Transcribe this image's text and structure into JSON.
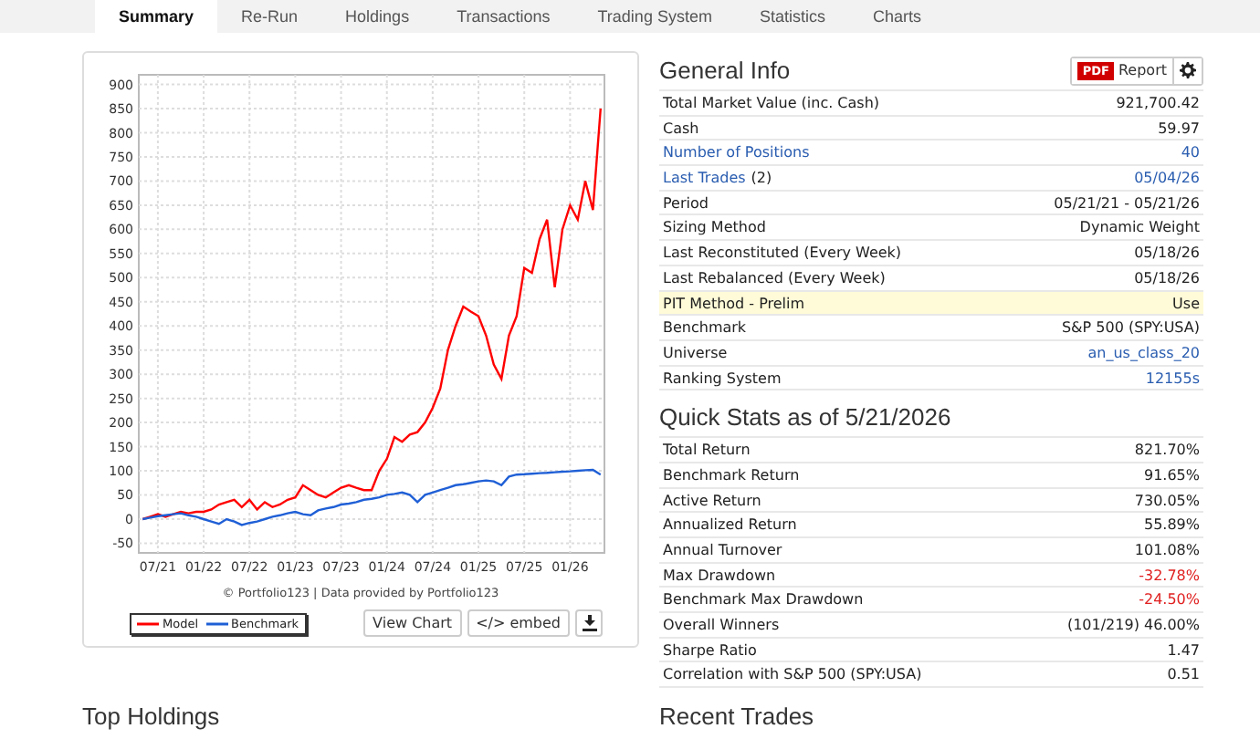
{
  "tabs": [
    {
      "label": "Summary",
      "selected": true
    },
    {
      "label": "Re-Run",
      "selected": false
    },
    {
      "label": "Holdings",
      "selected": false
    },
    {
      "label": "Transactions",
      "selected": false
    },
    {
      "label": "Trading System",
      "selected": false
    },
    {
      "label": "Statistics",
      "selected": false
    },
    {
      "label": "Charts",
      "selected": false
    }
  ],
  "chart": {
    "chart_data": {
      "type": "line",
      "categories": [
        null,
        null,
        "07/21",
        null,
        null,
        null,
        null,
        null,
        "01/22",
        null,
        null,
        null,
        null,
        null,
        "07/22",
        null,
        null,
        null,
        null,
        null,
        "01/23",
        null,
        null,
        null,
        null,
        null,
        "07/23",
        null,
        null,
        null,
        null,
        null,
        "01/24",
        null,
        null,
        null,
        null,
        null,
        "07/24",
        null,
        null,
        null,
        null,
        null,
        "01/25",
        null,
        null,
        null,
        null,
        null,
        "07/25",
        null,
        null,
        null,
        null,
        null,
        "01/26",
        null,
        null,
        null,
        null
      ],
      "series": [
        {
          "name": "Model",
          "color": "#ff0000",
          "values": [
            0,
            5,
            10,
            5,
            10,
            15,
            12,
            15,
            15,
            20,
            30,
            35,
            40,
            25,
            40,
            20,
            35,
            25,
            30,
            40,
            45,
            70,
            60,
            50,
            45,
            55,
            65,
            70,
            65,
            60,
            60,
            100,
            125,
            170,
            160,
            175,
            180,
            200,
            230,
            270,
            350,
            400,
            440,
            430,
            420,
            380,
            320,
            290,
            380,
            420,
            520,
            510,
            580,
            620,
            480,
            600,
            650,
            620,
            700,
            640,
            850
          ]
        },
        {
          "name": "Benchmark",
          "color": "#1f5fd6",
          "values": [
            0,
            3,
            6,
            8,
            10,
            12,
            8,
            5,
            0,
            -5,
            -10,
            0,
            -5,
            -12,
            -8,
            -5,
            0,
            5,
            8,
            12,
            15,
            10,
            8,
            18,
            22,
            25,
            30,
            32,
            35,
            40,
            42,
            45,
            50,
            52,
            55,
            50,
            35,
            50,
            55,
            60,
            65,
            70,
            72,
            75,
            78,
            80,
            78,
            70,
            88,
            92,
            93,
            94,
            95,
            96,
            97,
            98,
            99,
            100,
            101,
            102,
            92
          ]
        }
      ],
      "ylim": [
        -70,
        920
      ],
      "grid": true,
      "yticks": [
        -50,
        0,
        50,
        100,
        150,
        200,
        250,
        300,
        350,
        400,
        450,
        500,
        550,
        600,
        650,
        700,
        750,
        800,
        850,
        900
      ]
    },
    "credit": "© Portfolio123 | Data provided by Portfolio123",
    "buttons": [
      "View Chart",
      "</> embed"
    ]
  },
  "general_info": {
    "title": "General Info",
    "pdf_badge": "PDF",
    "report_button": "Report",
    "rows": [
      {
        "label": "Total Market Value (inc. Cash)",
        "value": "921,700.42",
        "label_link": false,
        "value_link": false,
        "highlighted": false
      },
      {
        "label": "Cash",
        "value": "59.97",
        "label_link": false,
        "value_link": false,
        "highlighted": false
      },
      {
        "label": "Number of Positions",
        "value": "40",
        "label_link": true,
        "value_link": true,
        "highlighted": false
      },
      {
        "label": "Last Trades",
        "count": "(2)",
        "value": "05/04/26",
        "label_link": true,
        "value_link": true,
        "highlighted": false
      },
      {
        "label": "Period",
        "value": "05/21/21 - 05/21/26",
        "label_link": false,
        "value_link": false,
        "highlighted": false
      },
      {
        "label": "Sizing Method",
        "value": "Dynamic Weight",
        "label_link": false,
        "value_link": false,
        "highlighted": false
      },
      {
        "label": "Last Reconstituted (Every Week)",
        "value": "05/18/26",
        "label_link": false,
        "value_link": false,
        "highlighted": false
      },
      {
        "label": "Last Rebalanced (Every Week)",
        "value": "05/18/26",
        "label_link": false,
        "value_link": false,
        "highlighted": false
      },
      {
        "label": "PIT Method - Prelim",
        "value": "Use",
        "label_link": false,
        "value_link": false,
        "highlighted": true
      },
      {
        "label": "Benchmark",
        "value": "S&P 500 (SPY:USA)",
        "label_link": false,
        "value_link": false,
        "highlighted": false
      },
      {
        "label": "Universe",
        "value": "an_us_class_20",
        "label_link": false,
        "value_link": true,
        "highlighted": false
      },
      {
        "label": "Ranking System",
        "value": "12155s",
        "label_link": false,
        "value_link": true,
        "highlighted": false
      }
    ]
  },
  "quick_stats": {
    "title": "Quick Stats as of 5/21/2026",
    "rows": [
      {
        "label": "Total Return",
        "value": "821.70%",
        "negative": false
      },
      {
        "label": "Benchmark Return",
        "value": "91.65%",
        "negative": false
      },
      {
        "label": "Active Return",
        "value": "730.05%",
        "negative": false
      },
      {
        "label": "Annualized Return",
        "value": "55.89%",
        "negative": false
      },
      {
        "label": "Annual Turnover",
        "value": "101.08%",
        "negative": false
      },
      {
        "label": "Max Drawdown",
        "value": "-32.78%",
        "negative": true
      },
      {
        "label": "Benchmark Max Drawdown",
        "value": "-24.50%",
        "negative": true
      },
      {
        "label": "Overall Winners",
        "value": "(101/219) 46.00%",
        "negative": false
      },
      {
        "label": "Sharpe Ratio",
        "value": "1.47",
        "negative": false
      },
      {
        "label": "Correlation with S&P 500 (SPY:USA)",
        "value": "0.51",
        "negative": false
      }
    ]
  },
  "sections": [
    "Top Holdings",
    "Recent Trades"
  ]
}
